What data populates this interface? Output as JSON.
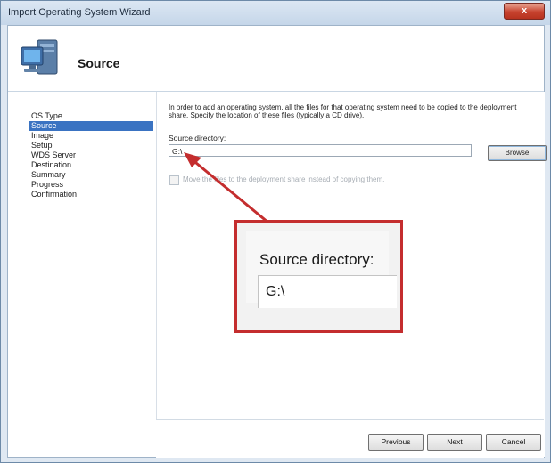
{
  "window": {
    "title": "Import Operating System Wizard",
    "close_label": "x"
  },
  "header": {
    "title": "Source",
    "icon": "computer-icon"
  },
  "sidebar": {
    "items": [
      {
        "label": "OS Type",
        "active": false
      },
      {
        "label": "Source",
        "active": true
      },
      {
        "label": "Image",
        "active": false
      },
      {
        "label": "Setup",
        "active": false
      },
      {
        "label": "WDS Server",
        "active": false
      },
      {
        "label": "Destination",
        "active": false
      },
      {
        "label": "Summary",
        "active": false
      },
      {
        "label": "Progress",
        "active": false
      },
      {
        "label": "Confirmation",
        "active": false
      }
    ]
  },
  "content": {
    "description": "In order to add an operating system, all the files for that operating system need to be copied to the deployment share.  Specify the location of these files (typically a CD drive).",
    "source_label": "Source directory:",
    "source_value": "G:\\",
    "browse_label": "Browse",
    "move_files_label": "Move the files to the deployment share instead of copying them.",
    "move_files_checked": false
  },
  "footer": {
    "previous_label": "Previous",
    "next_label": "Next",
    "cancel_label": "Cancel"
  },
  "callout": {
    "label": "Source directory:",
    "value": "G:\\",
    "accent_color": "#c42d2e"
  }
}
